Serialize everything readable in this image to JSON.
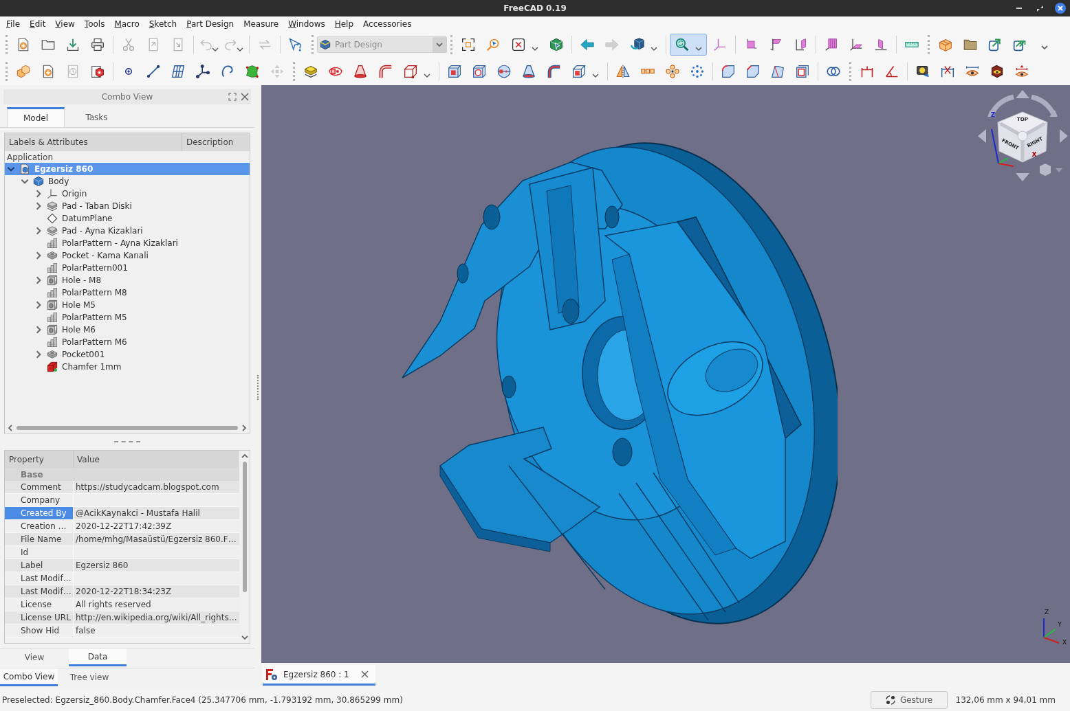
{
  "window": {
    "title": "FreeCAD 0.19"
  },
  "menu": [
    {
      "label": "File",
      "mnemonic": true
    },
    {
      "label": "Edit",
      "mnemonic": true
    },
    {
      "label": "View",
      "mnemonic": true
    },
    {
      "label": "Tools",
      "mnemonic": true
    },
    {
      "label": "Macro",
      "mnemonic": true
    },
    {
      "label": "Sketch",
      "mnemonic": true
    },
    {
      "label": "Part Design",
      "mnemonic": true
    },
    {
      "label": "Measure",
      "mnemonic": false
    },
    {
      "label": "Windows",
      "mnemonic": true
    },
    {
      "label": "Help",
      "mnemonic": true
    },
    {
      "label": "Accessories",
      "mnemonic": false
    }
  ],
  "toolbars": [
    {
      "workbench": "Part Design",
      "buttons": [
        {
          "pressed": false,
          "disabled": false
        },
        {
          "pressed": false,
          "disabled": false
        },
        {
          "pressed": false,
          "disabled": false
        },
        {
          "pressed": false,
          "disabled": false
        },
        {
          "pressed": false,
          "disabled": true
        },
        {
          "pressed": false,
          "disabled": true
        },
        {
          "pressed": false,
          "disabled": true
        },
        {
          "pressed": false,
          "disabled": true
        },
        {
          "pressed": false,
          "disabled": true
        },
        {
          "pressed": false,
          "disabled": true
        },
        {
          "pressed": false,
          "disabled": false
        },
        {
          "pressed": false,
          "disabled": false
        },
        {
          "pressed": false,
          "disabled": false
        },
        {
          "pressed": false,
          "disabled": false
        },
        {
          "pressed": false,
          "disabled": false
        },
        {
          "pressed": false,
          "disabled": false
        },
        {
          "pressed": false,
          "disabled": true
        },
        {
          "pressed": false,
          "disabled": false
        },
        {
          "pressed": true,
          "disabled": false
        },
        {
          "pressed": false,
          "disabled": false
        },
        {
          "pressed": false,
          "disabled": false
        },
        {
          "pressed": false,
          "disabled": false
        },
        {
          "pressed": false,
          "disabled": false
        },
        {
          "pressed": false,
          "disabled": false
        },
        {
          "pressed": false,
          "disabled": false
        },
        {
          "pressed": false,
          "disabled": false
        },
        {
          "pressed": false,
          "disabled": false
        },
        {
          "pressed": false,
          "disabled": false
        },
        {
          "pressed": false,
          "disabled": false
        },
        {
          "pressed": false,
          "disabled": false
        },
        {
          "pressed": false,
          "disabled": false
        }
      ]
    },
    {
      "buttons": [
        {
          "pressed": false,
          "disabled": false
        },
        {
          "pressed": false,
          "disabled": false
        },
        {
          "pressed": false,
          "disabled": true
        },
        {
          "pressed": false,
          "disabled": false
        },
        {
          "pressed": false,
          "disabled": false
        },
        {
          "pressed": false,
          "disabled": false
        },
        {
          "pressed": false,
          "disabled": false
        },
        {
          "pressed": false,
          "disabled": false
        },
        {
          "pressed": false,
          "disabled": false
        },
        {
          "pressed": false,
          "disabled": false
        },
        {
          "pressed": false,
          "disabled": true
        },
        {
          "pressed": false,
          "disabled": false
        },
        {
          "pressed": false,
          "disabled": false
        },
        {
          "pressed": false,
          "disabled": false
        },
        {
          "pressed": false,
          "disabled": false
        },
        {
          "pressed": false,
          "disabled": false
        },
        {
          "pressed": false,
          "disabled": false
        },
        {
          "pressed": false,
          "disabled": false
        },
        {
          "pressed": false,
          "disabled": false
        },
        {
          "pressed": false,
          "disabled": false
        },
        {
          "pressed": false,
          "disabled": false
        },
        {
          "pressed": false,
          "disabled": false
        },
        {
          "pressed": false,
          "disabled": false
        },
        {
          "pressed": false,
          "disabled": false
        },
        {
          "pressed": false,
          "disabled": false
        },
        {
          "pressed": false,
          "disabled": false
        },
        {
          "pressed": false,
          "disabled": false
        },
        {
          "pressed": false,
          "disabled": false
        },
        {
          "pressed": false,
          "disabled": false
        },
        {
          "pressed": false,
          "disabled": false
        },
        {
          "pressed": false,
          "disabled": false
        },
        {
          "pressed": false,
          "disabled": false
        },
        {
          "pressed": false,
          "disabled": false
        },
        {
          "pressed": false,
          "disabled": false
        },
        {
          "pressed": false,
          "disabled": false
        },
        {
          "pressed": false,
          "disabled": false
        },
        {
          "pressed": false,
          "disabled": false
        },
        {
          "pressed": false,
          "disabled": false
        }
      ]
    }
  ],
  "combo_view": {
    "title": "Combo View",
    "tabs": [
      {
        "label": "Model",
        "selected": true
      },
      {
        "label": "Tasks",
        "selected": false
      }
    ],
    "tree": {
      "columns": [
        "Labels & Attributes",
        "Description"
      ],
      "root": "Application",
      "items": [
        {
          "label": "Egzersiz 860",
          "kind": "document",
          "selected": true,
          "has_children": true,
          "expanded": true,
          "children": [
            {
              "label": "Body",
              "kind": "body",
              "selected": false,
              "has_children": true,
              "expanded": true,
              "children": [
                {
                  "label": "Origin",
                  "kind": "origin",
                  "selected": false,
                  "has_children": true,
                  "expanded": false
                },
                {
                  "label": "Pad - Taban Diski",
                  "kind": "pad",
                  "selected": false,
                  "has_children": true,
                  "expanded": false
                },
                {
                  "label": "DatumPlane",
                  "kind": "datum",
                  "selected": false,
                  "has_children": false
                },
                {
                  "label": "Pad - Ayna Kizaklari",
                  "kind": "pad",
                  "selected": false,
                  "has_children": true,
                  "expanded": false
                },
                {
                  "label": "PolarPattern - Ayna Kizaklari",
                  "kind": "pattern",
                  "selected": false,
                  "has_children": false
                },
                {
                  "label": "Pocket - Kama Kanali",
                  "kind": "pocket",
                  "selected": false,
                  "has_children": true,
                  "expanded": false
                },
                {
                  "label": "PolarPattern001",
                  "kind": "pattern",
                  "selected": false,
                  "has_children": false
                },
                {
                  "label": "Hole - M8",
                  "kind": "hole",
                  "selected": false,
                  "has_children": true,
                  "expanded": false
                },
                {
                  "label": "PolarPattern M8",
                  "kind": "pattern",
                  "selected": false,
                  "has_children": false
                },
                {
                  "label": "Hole M5",
                  "kind": "hole",
                  "selected": false,
                  "has_children": true,
                  "expanded": false
                },
                {
                  "label": "PolarPattern M5",
                  "kind": "pattern",
                  "selected": false,
                  "has_children": false
                },
                {
                  "label": "Hole M6",
                  "kind": "hole",
                  "selected": false,
                  "has_children": true,
                  "expanded": false
                },
                {
                  "label": "PolarPattern M6",
                  "kind": "pattern",
                  "selected": false,
                  "has_children": false
                },
                {
                  "label": "Pocket001",
                  "kind": "pocket",
                  "selected": false,
                  "has_children": true,
                  "expanded": false
                },
                {
                  "label": "Chamfer 1mm",
                  "kind": "chamfer",
                  "selected": false,
                  "has_children": false
                }
              ]
            }
          ]
        }
      ]
    },
    "properties": {
      "columns": [
        "Property",
        "Value"
      ],
      "groups": [
        {
          "label": "Base",
          "rows": [
            {
              "name": "Comment",
              "value": "https://studycadcam.blogspot.com",
              "selected": false
            },
            {
              "name": "Company",
              "selected": false
            },
            {
              "name": "Created By",
              "value": "@AcikKaynakci - Mustafa Halil",
              "selected": true
            },
            {
              "name": "Creation …",
              "value": "2020-12-22T17:42:39Z",
              "selected": false
            },
            {
              "name": "File Name",
              "value": "/home/mhg/Masaüstü/Egzersiz 860.F…",
              "selected": false
            },
            {
              "name": "Id",
              "selected": false
            },
            {
              "name": "Label",
              "value": "Egzersiz 860",
              "selected": false
            },
            {
              "name": "Last Modif…",
              "selected": false
            },
            {
              "name": "Last Modif…",
              "value": "2020-12-22T18:34:23Z",
              "selected": false
            },
            {
              "name": "License",
              "value": "All rights reserved",
              "selected": false
            },
            {
              "name": "License URL",
              "value": "http://en.wikipedia.org/wiki/All_rights…",
              "selected": false
            },
            {
              "name": "Show Hid",
              "value": "false",
              "selected": false
            }
          ]
        }
      ]
    },
    "property_tabs": [
      {
        "label": "View",
        "selected": false
      },
      {
        "label": "Data",
        "selected": true
      }
    ]
  },
  "panel_tabs": [
    {
      "label": "Combo View",
      "selected": true
    },
    {
      "label": "Tree view",
      "selected": false
    }
  ],
  "viewport": {
    "nav_cube": {
      "faces": [
        "TOP",
        "FRONT",
        "RIGHT"
      ],
      "axes": [
        "Z",
        "X"
      ]
    },
    "axis_triad": [
      "Z",
      "Y",
      "X"
    ]
  },
  "document_tabs": [
    {
      "label": "Egzersiz 860 : 1",
      "selected": true
    }
  ],
  "status_bar": {
    "message": "Preselected: Egzersiz_860.Body.Chamfer.Face4 (25.347706 mm, -1.793192 mm, 30.865299 mm)",
    "navigation_style": "Gesture",
    "dimensions": "132,06 mm x 94,01 mm"
  }
}
